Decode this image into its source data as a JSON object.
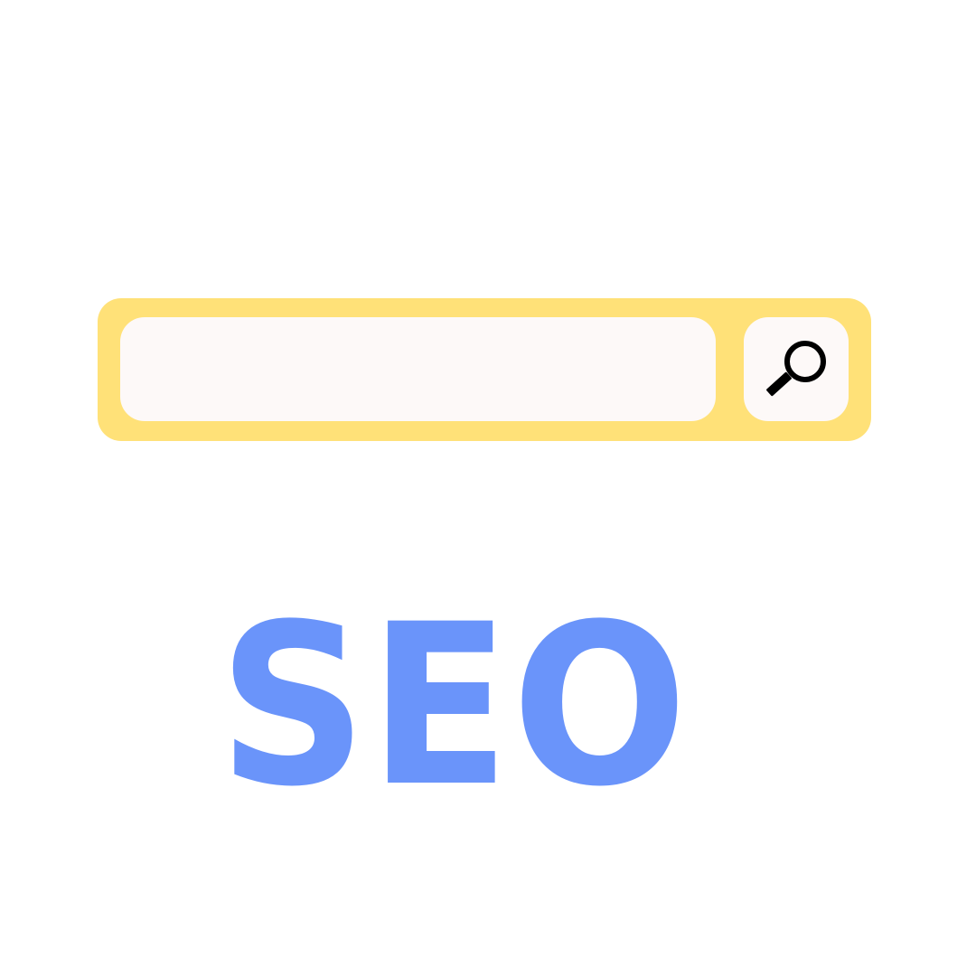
{
  "colors": {
    "background": "#ffffff",
    "search_bar_frame": "#ffe178",
    "search_field": "#fdf9f8",
    "title": "#6a94fa",
    "icon": "#000000"
  },
  "search": {
    "value": "",
    "placeholder": "",
    "button_icon": "magnifying-glass-icon"
  },
  "title": {
    "text": "SEO"
  }
}
